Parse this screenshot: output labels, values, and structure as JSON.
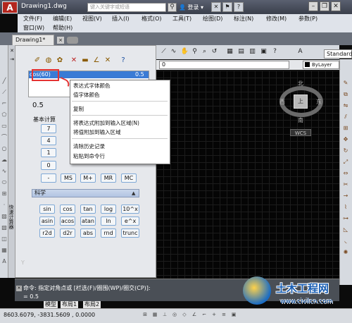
{
  "window": {
    "title": "Drawing1.dwg",
    "search_placeholder": "键入关键字或短语",
    "user_label": "登录",
    "app_logo": "A"
  },
  "menu": {
    "row1": [
      "文件(F)",
      "编辑(E)",
      "视图(V)",
      "插入(I)",
      "格式(O)",
      "工具(T)",
      "绘图(D)",
      "标注(N)",
      "修改(M)",
      "参数(P)"
    ],
    "row2": [
      "窗口(W)",
      "帮助(H)"
    ]
  },
  "tabs": {
    "doc_tab": "Drawing1*",
    "close": "×"
  },
  "properties_bar": {
    "layer": "0",
    "color": "ByLayer",
    "style": "Standard"
  },
  "viewcube": {
    "top": "上",
    "north": "北",
    "south": "南",
    "west": "西",
    "east": "东",
    "wcs": "WCS"
  },
  "calculator": {
    "history_expr": "cos(60)",
    "history_result": "0.5",
    "input_value": "0.5",
    "basic_section": "基本计算",
    "basic_buttons": [
      [
        "7"
      ],
      [
        "4"
      ],
      [
        "1"
      ],
      [
        "0"
      ]
    ],
    "memory_buttons": [
      "MS",
      "M+",
      "MR",
      "MC"
    ],
    "scientific_title": "科学",
    "sci_buttons": [
      [
        "sin",
        "cos",
        "tan",
        "log",
        "10^x"
      ],
      [
        "asin",
        "acos",
        "atan",
        "ln",
        "e^x"
      ],
      [
        "r2d",
        "d2r",
        "abs",
        "rnd",
        "trunc"
      ]
    ],
    "strip_title": "快速计算器"
  },
  "context_menu": {
    "items": [
      "表达式字体颜色",
      "值字体颜色",
      "复制",
      "将表达式附加到输入区域(N)",
      "将值附加到输入区域",
      "清除历史记录",
      "粘贴到命令行"
    ]
  },
  "command": {
    "line1": "命令: 指定对角点或 [栏选(F)/圈围(WP)/圈交(CP)]:",
    "line2": "= 0.5",
    "layout_tabs": [
      "模型",
      "布局1",
      "布局2"
    ]
  },
  "status": {
    "coords": "8603.6079,   -3831.5609 , 0.0000"
  },
  "watermark": {
    "title": "土木工程网",
    "url": "www.civilcn.com"
  }
}
